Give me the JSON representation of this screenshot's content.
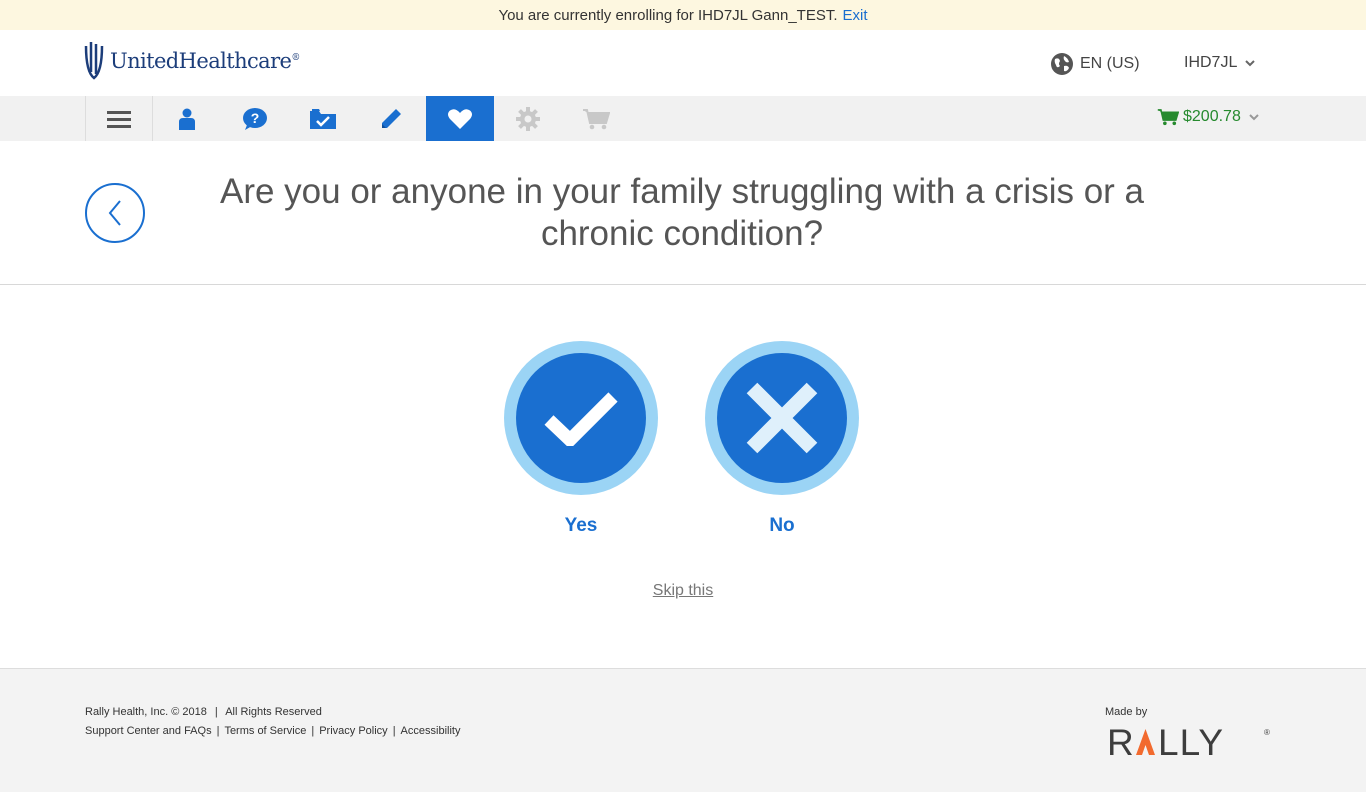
{
  "banner": {
    "text": "You are currently enrolling for IHD7JL Gann_TEST.",
    "exit_label": "Exit"
  },
  "header": {
    "logo_text": "UnitedHealthcare",
    "logo_mark": "®",
    "language": "EN (US)",
    "user": "IHD7JL"
  },
  "nav": {
    "items": [
      {
        "icon": "menu-icon"
      },
      {
        "icon": "person-icon"
      },
      {
        "icon": "help-icon"
      },
      {
        "icon": "folder-check-icon"
      },
      {
        "icon": "pencil-icon"
      },
      {
        "icon": "heart-icon",
        "active": true
      },
      {
        "icon": "gear-icon",
        "disabled": true
      },
      {
        "icon": "cart-icon",
        "disabled": true
      }
    ],
    "cart_total": "$200.78"
  },
  "question": {
    "text": "Are you or anyone in your family struggling with a crisis or a chronic condition?"
  },
  "choices": {
    "yes_label": "Yes",
    "no_label": "No"
  },
  "skip_label": "Skip this",
  "footer": {
    "copyright": "Rally Health, Inc. © 2018",
    "rights": "All Rights Reserved",
    "links": [
      "Support Center and FAQs",
      "Terms of Service",
      "Privacy Policy",
      "Accessibility"
    ],
    "made_by": "Made by",
    "brand": "RALLY"
  },
  "colors": {
    "primary": "#1a6fd0",
    "banner_bg": "#fdf7e0",
    "cart_green": "#268a2e",
    "choice_ring": "#9bd4f5"
  }
}
